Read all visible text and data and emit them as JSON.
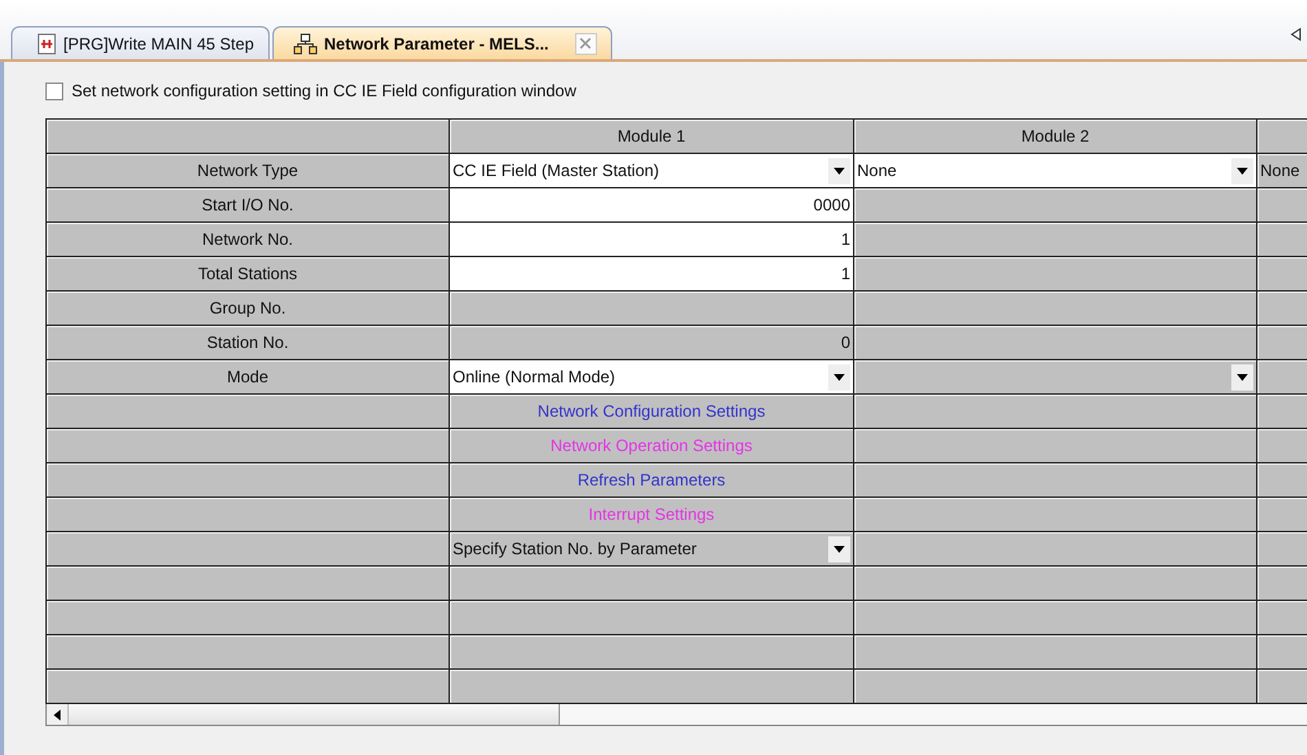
{
  "tabs": [
    {
      "label": "[PRG]Write MAIN 45 Step",
      "selected": false
    },
    {
      "label": "Network Parameter - MELS...",
      "selected": true
    }
  ],
  "option": {
    "label": "Set network configuration setting in CC IE Field configuration window",
    "checked": false
  },
  "grid": {
    "columns": [
      {
        "header": "Module 1"
      },
      {
        "header": "Module 2"
      }
    ],
    "rows": [
      {
        "label": "Network Type",
        "cells": [
          {
            "kind": "dropdown",
            "value": "CC IE Field (Master Station)",
            "disabled": false
          },
          {
            "kind": "dropdown",
            "value": "None",
            "disabled": false
          },
          {
            "kind": "text",
            "value": "None"
          }
        ]
      },
      {
        "label": "Start I/O No.",
        "cells": [
          {
            "kind": "input",
            "value": "0000"
          },
          {
            "kind": "blank"
          },
          {
            "kind": "blank"
          }
        ]
      },
      {
        "label": "Network No.",
        "cells": [
          {
            "kind": "input",
            "value": "1"
          },
          {
            "kind": "blank"
          },
          {
            "kind": "blank"
          }
        ]
      },
      {
        "label": "Total Stations",
        "cells": [
          {
            "kind": "input",
            "value": "1"
          },
          {
            "kind": "blank"
          },
          {
            "kind": "blank"
          }
        ]
      },
      {
        "label": "Group No.",
        "cells": [
          {
            "kind": "blank"
          },
          {
            "kind": "blank"
          },
          {
            "kind": "blank"
          }
        ]
      },
      {
        "label": "Station No.",
        "cells": [
          {
            "kind": "readonly",
            "value": "0"
          },
          {
            "kind": "blank"
          },
          {
            "kind": "blank"
          }
        ]
      },
      {
        "label": "Mode",
        "cells": [
          {
            "kind": "dropdown",
            "value": "Online (Normal Mode)",
            "disabled": false
          },
          {
            "kind": "dropdown",
            "disabled": true
          },
          {
            "kind": "blank"
          }
        ]
      },
      {
        "cells": [
          {
            "kind": "link",
            "value": "Network Configuration Settings",
            "color": "#3333cc"
          },
          {
            "kind": "blank"
          },
          {
            "kind": "blank"
          }
        ]
      },
      {
        "cells": [
          {
            "kind": "link",
            "value": "Network Operation Settings",
            "color": "#e633e6"
          },
          {
            "kind": "blank"
          },
          {
            "kind": "blank"
          }
        ]
      },
      {
        "cells": [
          {
            "kind": "link",
            "value": "Refresh Parameters",
            "color": "#3333cc"
          },
          {
            "kind": "blank"
          },
          {
            "kind": "blank"
          }
        ]
      },
      {
        "cells": [
          {
            "kind": "link",
            "value": "Interrupt Settings",
            "color": "#e633e6"
          },
          {
            "kind": "blank"
          },
          {
            "kind": "blank"
          }
        ]
      },
      {
        "cells": [
          {
            "kind": "dropdown",
            "value": "Specify Station No. by Parameter",
            "disabled": true
          },
          {
            "kind": "blank"
          },
          {
            "kind": "blank"
          }
        ]
      },
      {
        "cells": [
          {
            "kind": "blank"
          },
          {
            "kind": "blank"
          },
          {
            "kind": "blank"
          }
        ]
      },
      {
        "cells": [
          {
            "kind": "blank"
          },
          {
            "kind": "blank"
          },
          {
            "kind": "blank"
          }
        ]
      },
      {
        "cells": [
          {
            "kind": "blank"
          },
          {
            "kind": "blank"
          },
          {
            "kind": "blank"
          }
        ]
      },
      {
        "cells": [
          {
            "kind": "blank"
          },
          {
            "kind": "blank"
          },
          {
            "kind": "blank"
          }
        ]
      }
    ]
  }
}
